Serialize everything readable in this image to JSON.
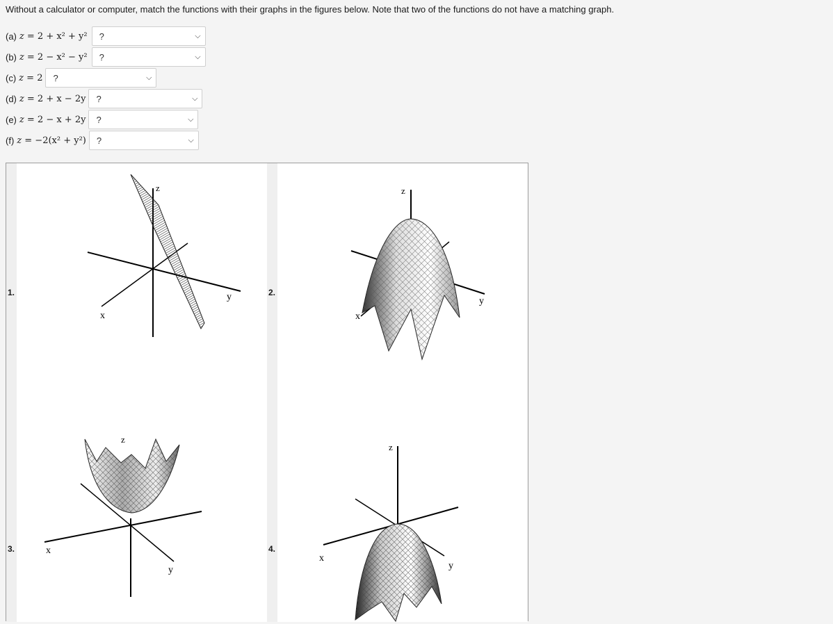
{
  "instructions": "Without a calculator or computer, match the functions with their graphs in the figures below. Note that two of the functions do not have a matching graph.",
  "questions": [
    {
      "label": "(a)",
      "lhs": "z",
      "rhs": "= 2 + x² + y²",
      "selected": "?"
    },
    {
      "label": "(b)",
      "lhs": "z",
      "rhs": "= 2 − x² − y²",
      "selected": "?"
    },
    {
      "label": "(c)",
      "lhs": "z",
      "rhs": "= 2",
      "selected": "?"
    },
    {
      "label": "(d)",
      "lhs": "z",
      "rhs": "= 2 + x − 2y",
      "selected": "?"
    },
    {
      "label": "(e)",
      "lhs": "z",
      "rhs": "= 2 − x + 2y",
      "selected": "?"
    },
    {
      "label": "(f)",
      "lhs": "z",
      "rhs": "= −2(x² + y²)",
      "selected": "?"
    }
  ],
  "figures": [
    {
      "number": "1.",
      "axes": {
        "x": "x",
        "y": "y",
        "z": "z"
      }
    },
    {
      "number": "2.",
      "axes": {
        "x": "x",
        "y": "y",
        "z": "z"
      }
    },
    {
      "number": "3.",
      "axes": {
        "x": "x",
        "y": "y",
        "z": "z"
      }
    },
    {
      "number": "4.",
      "axes": {
        "x": "x",
        "y": "y",
        "z": "z"
      }
    }
  ],
  "icons": {
    "dropdown": "chevron-down-icon"
  }
}
